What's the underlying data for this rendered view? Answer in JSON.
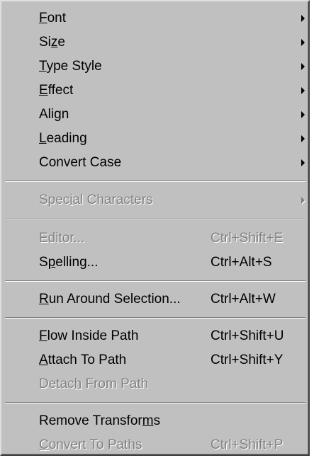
{
  "menu": {
    "items": [
      {
        "pre": "",
        "mn": "F",
        "post": "ont",
        "shortcut": "",
        "submenu": true,
        "disabled": false
      },
      {
        "pre": "Si",
        "mn": "z",
        "post": "e",
        "shortcut": "",
        "submenu": true,
        "disabled": false
      },
      {
        "pre": "",
        "mn": "T",
        "post": "ype Style",
        "shortcut": "",
        "submenu": true,
        "disabled": false
      },
      {
        "pre": "",
        "mn": "E",
        "post": "ffect",
        "shortcut": "",
        "submenu": true,
        "disabled": false
      },
      {
        "pre": "Ali",
        "mn": "g",
        "post": "n",
        "shortcut": "",
        "submenu": true,
        "disabled": false
      },
      {
        "pre": "",
        "mn": "L",
        "post": "eading",
        "shortcut": "",
        "submenu": true,
        "disabled": false
      },
      {
        "pre": "Convert Case",
        "mn": "",
        "post": "",
        "shortcut": "",
        "submenu": true,
        "disabled": false
      },
      {
        "pre": "Spec",
        "mn": "i",
        "post": "al Characters",
        "shortcut": "",
        "submenu": true,
        "disabled": true
      },
      {
        "pre": "Ed",
        "mn": "i",
        "post": "tor...",
        "shortcut": "Ctrl+Shift+E",
        "submenu": false,
        "disabled": true
      },
      {
        "pre": "S",
        "mn": "p",
        "post": "elling...",
        "shortcut": "Ctrl+Alt+S",
        "submenu": false,
        "disabled": false
      },
      {
        "pre": "",
        "mn": "R",
        "post": "un Around Selection...",
        "shortcut": "Ctrl+Alt+W",
        "submenu": false,
        "disabled": false
      },
      {
        "pre": "",
        "mn": "F",
        "post": "low Inside Path",
        "shortcut": "Ctrl+Shift+U",
        "submenu": false,
        "disabled": false
      },
      {
        "pre": "",
        "mn": "A",
        "post": "ttach To Path",
        "shortcut": "Ctrl+Shift+Y",
        "submenu": false,
        "disabled": false
      },
      {
        "pre": "Detac",
        "mn": "h",
        "post": " From Path",
        "shortcut": "",
        "submenu": false,
        "disabled": true
      },
      {
        "pre": "Remove Transfor",
        "mn": "m",
        "post": "s",
        "shortcut": "",
        "submenu": false,
        "disabled": false
      },
      {
        "pre": "",
        "mn": "C",
        "post": "onvert To Paths",
        "shortcut": "Ctrl+Shift+P",
        "submenu": false,
        "disabled": true
      }
    ]
  },
  "colors": {
    "menu_background": "#c0c0c0",
    "disabled_text": "#808080",
    "highlight": "#ffffff",
    "text": "#000000"
  }
}
